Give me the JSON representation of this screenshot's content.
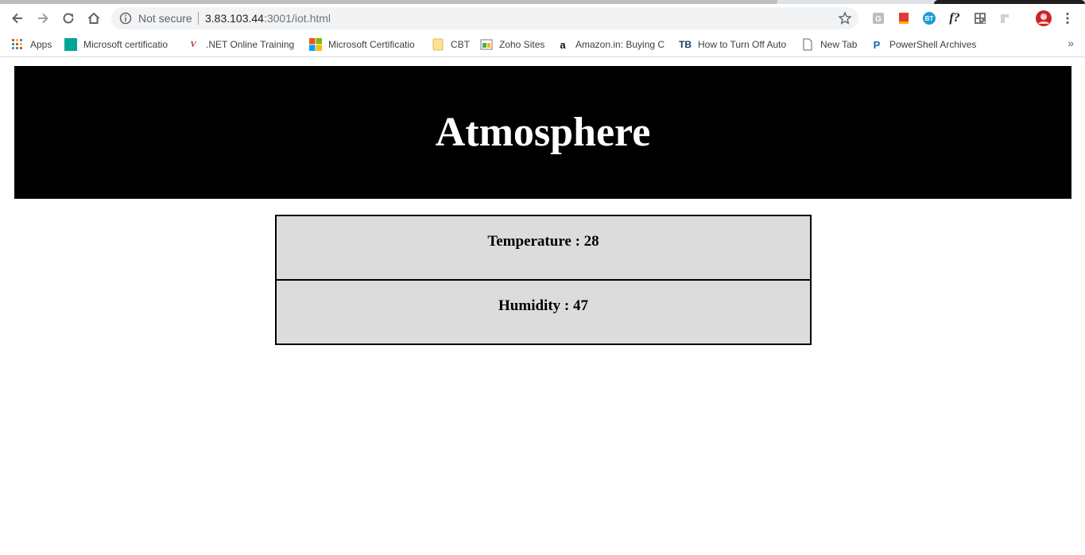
{
  "browser": {
    "security_label": "Not secure",
    "url_host": "3.83.103.44",
    "url_rest": ":3001/iot.html",
    "bookmarks": [
      {
        "label": "Apps",
        "icon": "apps-grid-icon"
      },
      {
        "label": "Microsoft certificatio",
        "icon": "teal-square-icon"
      },
      {
        "label": ".NET Online Training",
        "icon": "dotnet-logo-icon"
      },
      {
        "label": "Microsoft Certificatio",
        "icon": "microsoft-logo-icon"
      },
      {
        "label": "CBT",
        "icon": "folder-icon"
      },
      {
        "label": "Zoho Sites",
        "icon": "zoho-icon"
      },
      {
        "label": "Amazon.in: Buying Ch",
        "icon": "amazon-icon"
      },
      {
        "label": "How to Turn Off Auto",
        "icon": "tb-logo-icon"
      },
      {
        "label": "New Tab",
        "icon": "page-icon"
      },
      {
        "label": "PowerShell Archives -",
        "icon": "p-logo-icon"
      }
    ],
    "more_label": "»",
    "extensions": {
      "bt_label": "BT",
      "f_label": "f?"
    },
    "colors": {
      "bookmark_text": "#3c4043",
      "omnibox_bg": "#f1f3f4"
    }
  },
  "page": {
    "title": "Atmosphere",
    "readings": [
      {
        "text": "Temperature : 28"
      },
      {
        "text": "Humidity : 47"
      }
    ],
    "colors": {
      "banner_bg": "#000000",
      "banner_text": "#ffffff",
      "cell_bg": "#dcdcdc"
    }
  }
}
